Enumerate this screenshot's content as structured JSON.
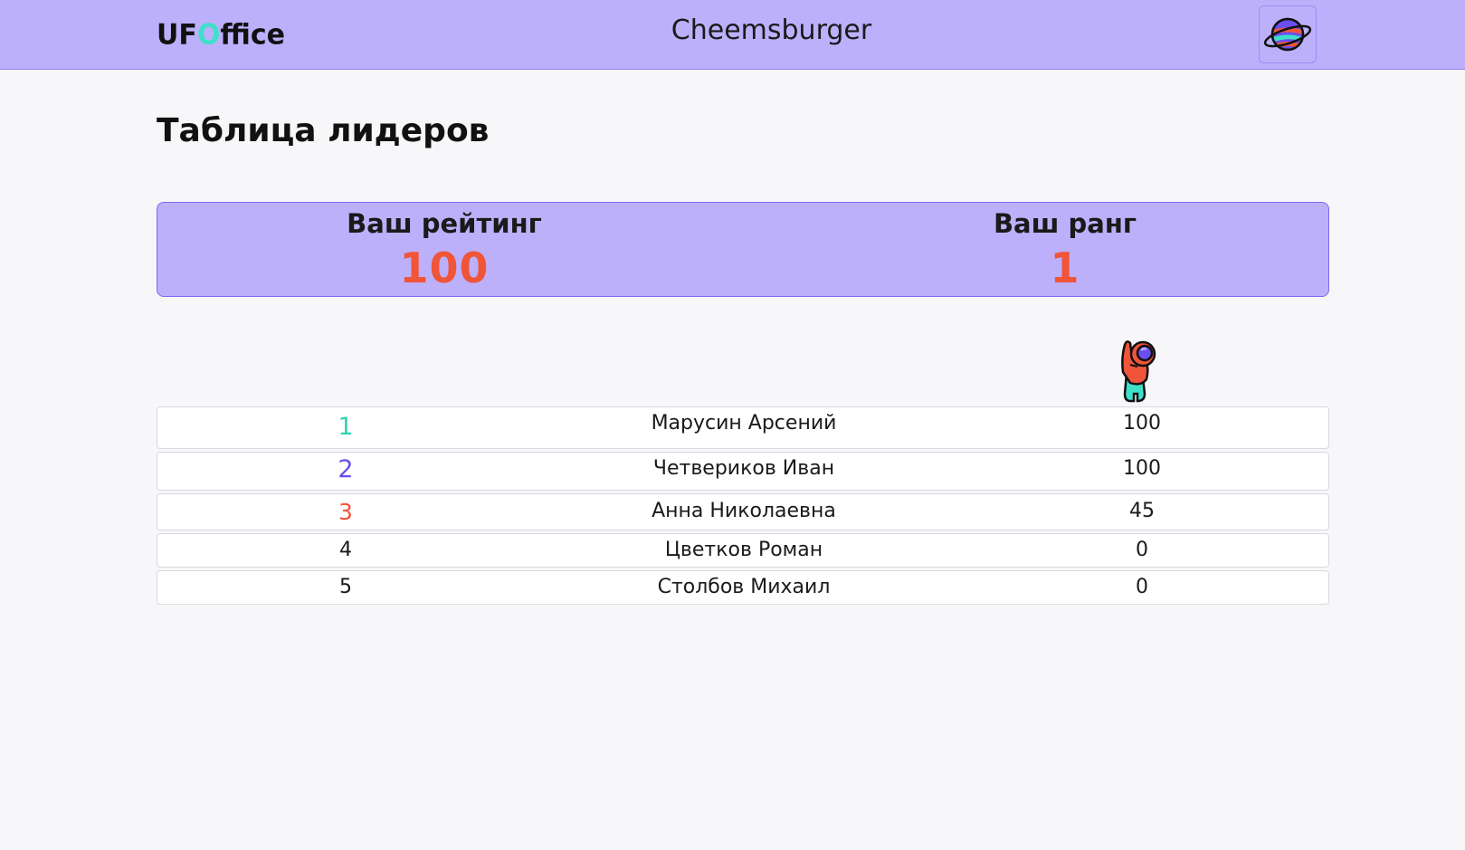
{
  "header": {
    "logo_prefix": "UF",
    "logo_o": "O",
    "logo_suffix": "ffice",
    "title": "Cheemsburger",
    "profile_icon": "planet-icon",
    "background": "#bdb0fb"
  },
  "page": {
    "title": "Таблица лидеров"
  },
  "stats": {
    "rating_label": "Ваш рейтинг",
    "rating_value": "100",
    "rank_label": "Ваш ранг",
    "rank_value": "1",
    "value_color": "#f0553a"
  },
  "leaderboard": {
    "icon": "astronaut-icon",
    "rows": [
      {
        "place": "1",
        "name": "Марусин Арсений",
        "score": "100"
      },
      {
        "place": "2",
        "name": "Четвериков Иван",
        "score": "100"
      },
      {
        "place": "3",
        "name": "Анна Николаевна",
        "score": "45"
      },
      {
        "place": "4",
        "name": "Цветков Роман",
        "score": "0"
      },
      {
        "place": "5",
        "name": "Столбов Михаил",
        "score": "0"
      }
    ],
    "place_colors": {
      "1": "#2ed4b4",
      "2": "#6b4ef0",
      "3": "#f0553a"
    }
  }
}
